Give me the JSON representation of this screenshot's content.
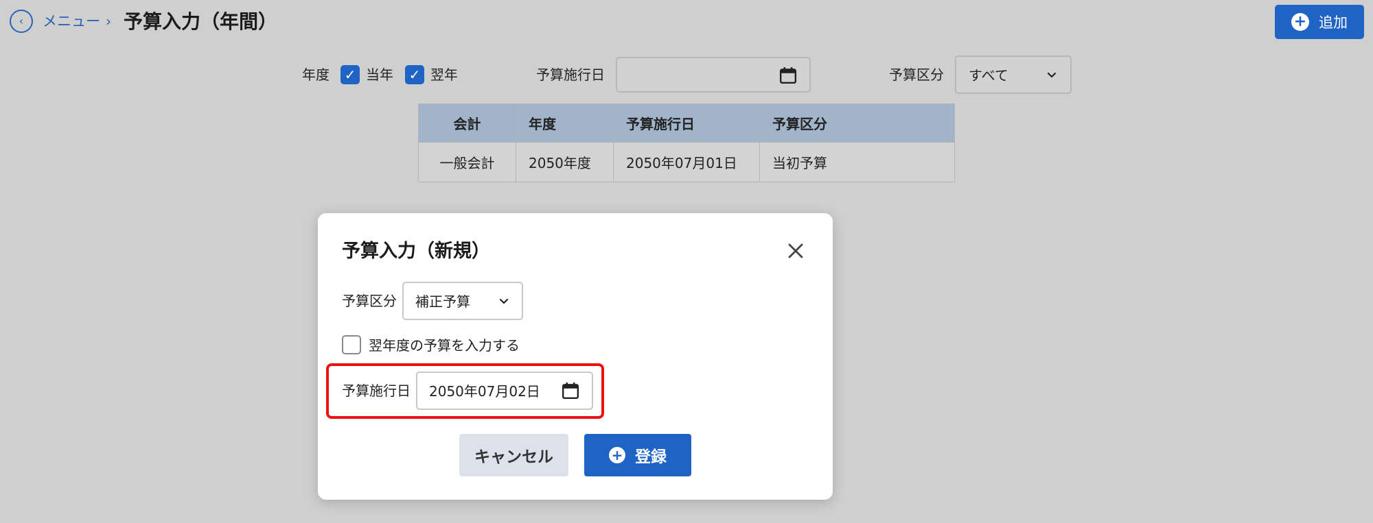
{
  "header": {
    "back_icon": "chevron-left-icon",
    "breadcrumb_menu": "メニュー",
    "breadcrumb_sep": "›",
    "title": "予算入力（年間）",
    "add_label": "追加"
  },
  "filters": {
    "year_label": "年度",
    "current_year_label": "当年",
    "current_year_checked": true,
    "next_year_label": "翌年",
    "next_year_checked": true,
    "effective_date_label": "予算施行日",
    "effective_date_value": "",
    "category_label": "予算区分",
    "category_value": "すべて"
  },
  "table": {
    "headers": [
      "会計",
      "年度",
      "予算施行日",
      "予算区分"
    ],
    "rows": [
      [
        "一般会計",
        "2050年度",
        "2050年07月01日",
        "当初予算"
      ]
    ]
  },
  "modal": {
    "title": "予算入力（新規）",
    "category_label": "予算区分",
    "category_value": "補正予算",
    "next_year_checkbox_label": "翌年度の予算を入力する",
    "next_year_checked": false,
    "effective_date_label": "予算施行日",
    "effective_date_value": "2050年07月02日",
    "cancel_label": "キャンセル",
    "register_label": "登録"
  },
  "colors": {
    "accent": "#1f64c4",
    "highlight": "#ee1111",
    "table_header": "#a1b4c9",
    "overlay_bg": "#cfcfcf"
  }
}
